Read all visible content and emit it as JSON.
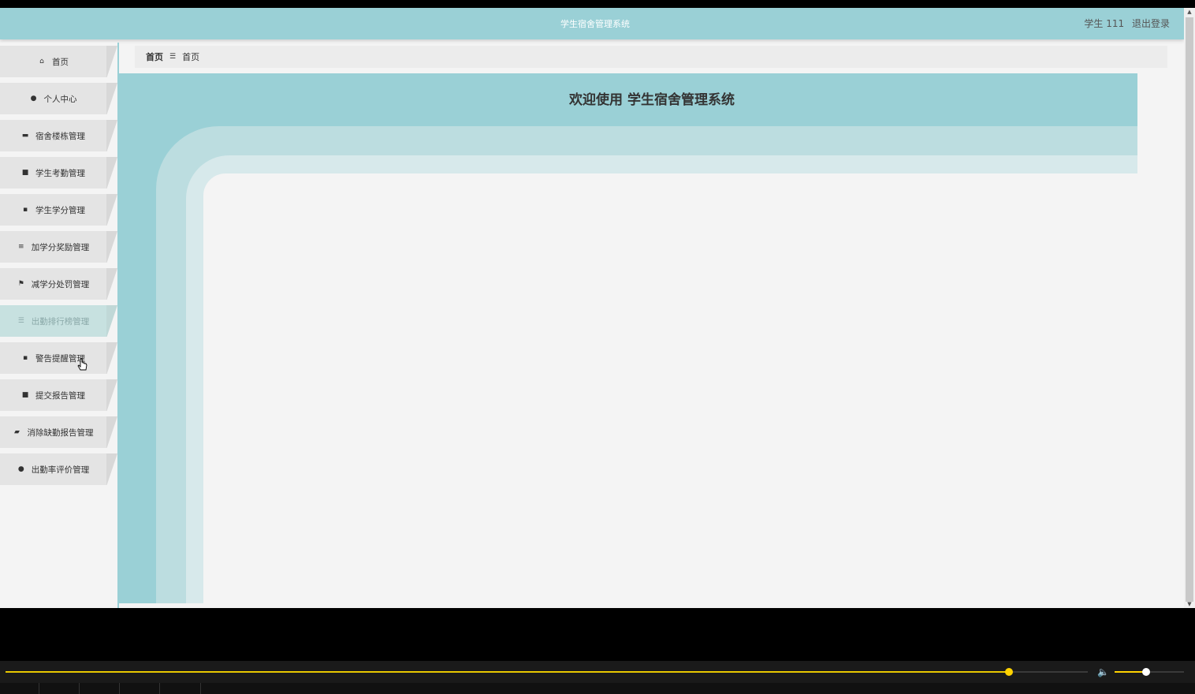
{
  "header": {
    "title": "学生宿舍管理系统",
    "user_label": "学生 111",
    "logout_label": "退出登录"
  },
  "sidebar": {
    "items": [
      {
        "label": "首页",
        "icon": "home-icon",
        "glyph": "⌂"
      },
      {
        "label": "个人中心",
        "icon": "user-icon",
        "glyph": "●"
      },
      {
        "label": "宿舍楼栋管理",
        "icon": "ticket-icon",
        "glyph": "▬"
      },
      {
        "label": "学生考勤管理",
        "icon": "comment-icon",
        "glyph": "■"
      },
      {
        "label": "学生学分管理",
        "icon": "grid-icon",
        "glyph": "▪"
      },
      {
        "label": "加学分奖励管理",
        "icon": "list-icon",
        "glyph": "≡"
      },
      {
        "label": "减学分处罚管理",
        "icon": "flag-icon",
        "glyph": "⚑"
      },
      {
        "label": "出勤排行榜管理",
        "icon": "sliders-icon",
        "glyph": "☰"
      },
      {
        "label": "警告提醒管理",
        "icon": "grid-icon",
        "glyph": "▪"
      },
      {
        "label": "提交报告管理",
        "icon": "briefcase-icon",
        "glyph": "■"
      },
      {
        "label": "消除缺勤报告管理",
        "icon": "mailbox-icon",
        "glyph": "▰"
      },
      {
        "label": "出勤率评价管理",
        "icon": "map-pin-icon",
        "glyph": "●"
      }
    ],
    "active_index": 7
  },
  "breadcrumb": {
    "root": "首页",
    "separator": "☰",
    "current": "首页"
  },
  "main": {
    "welcome": "欢迎使用 学生宿舍管理系统"
  },
  "colors": {
    "accent": "#9ad0d6",
    "active_item": "#c7e1e0",
    "progress": "#ffd200"
  },
  "player": {
    "progress": 0.927,
    "volume": 0.45
  }
}
